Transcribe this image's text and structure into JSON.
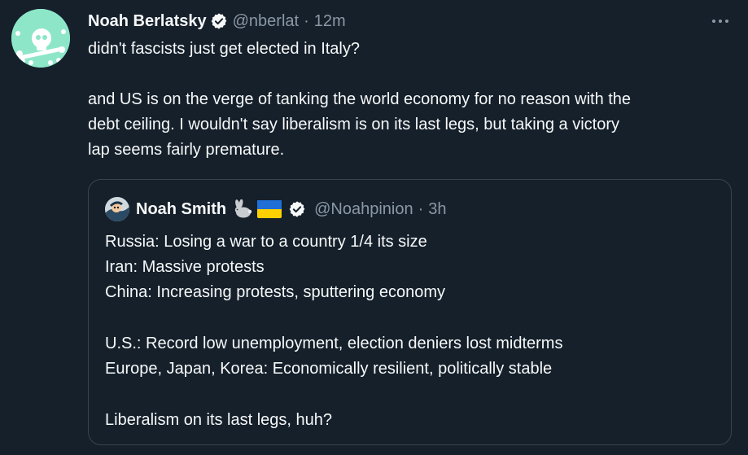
{
  "tweet": {
    "author_name": "Noah Berlatsky",
    "author_handle": "@nberlat",
    "separator": "·",
    "time": "12m",
    "avatar_icon": "skull-avatar-icon",
    "verified_icon": "verified-badge-icon",
    "more_icon": "more-options-icon",
    "text_lines": [
      "didn't fascists just get elected in Italy?",
      "and US is on the verge of tanking the world economy for no reason with the",
      "debt ceiling. I wouldn't say liberalism is on its last legs, but taking a victory",
      "lap seems fairly premature."
    ]
  },
  "quoted_tweet": {
    "author_name": "Noah Smith",
    "author_handle": "@Noahpinion",
    "separator": "·",
    "time": "3h",
    "name_emojis": [
      "rabbit-emoji",
      "ukraine-flag-emoji"
    ],
    "text_lines": [
      "Russia: Losing a war to a country 1/4 its size",
      "Iran: Massive protests",
      "China: Increasing protests, sputtering economy",
      "U.S.: Record low unemployment, election deniers lost midterms",
      "Europe, Japan, Korea: Economically resilient, politically stable",
      "Liberalism on its last legs, huh?"
    ]
  },
  "colors": {
    "background": "#15202b",
    "text": "#f7f9f9",
    "muted": "#8b98a5",
    "border": "#38444d",
    "verified": "#f7f9f9"
  }
}
